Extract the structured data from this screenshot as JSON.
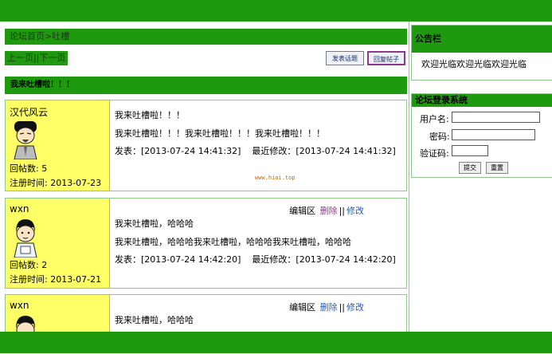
{
  "breadcrumb": {
    "home": "论坛首页",
    "sep": ">",
    "current": "吐槽"
  },
  "pager": {
    "prev": "上一页",
    "sep": "||",
    "next": "下一页"
  },
  "buttons": {
    "new_topic": "发表话题",
    "reply": "回复帖子"
  },
  "thread": {
    "title": "我来吐槽啦！！！"
  },
  "edit_labels": {
    "area": "编辑区",
    "delete": "删除",
    "sep": "||",
    "modify": "修改"
  },
  "posts": [
    {
      "user": "汉代风云",
      "reply_count": "回帖数: 5",
      "register": "注册时间: 2013-07-23",
      "title": "我来吐槽啦！！！",
      "body": "我来吐槽啦！！！我来吐槽啦！！！我来吐槽啦！！！",
      "posted": "发表：[2013-07-24 14:41:32]",
      "modified": "最近修改：[2013-07-24 14:41:32]"
    },
    {
      "user": "wxn",
      "reply_count": "回帖数: 2",
      "register": "注册时间: 2013-07-21",
      "title": "我来吐槽啦，哈哈哈",
      "body": "我来吐槽啦，哈哈哈我来吐槽啦，哈哈哈我来吐槽啦，哈哈哈",
      "posted": "发表：[2013-07-24 14:42:20]",
      "modified": "最近修改：[2013-07-24 14:42:20]"
    },
    {
      "user": "wxn",
      "title": "我来吐槽啦，哈哈哈"
    }
  ],
  "watermark": "www.hiai.top",
  "notice": {
    "header": "公告栏",
    "text": "欢迎光临欢迎光临欢迎光临"
  },
  "login": {
    "header": "论坛登录系统",
    "username_label": "用户名:",
    "password_label": "密码:",
    "captcha_label": "验证码:",
    "submit": "提交",
    "reset": "重置"
  },
  "colors": {
    "brand_green": "#1f9a0f",
    "user_panel": "#ffff66",
    "border": "#8fc88a"
  }
}
